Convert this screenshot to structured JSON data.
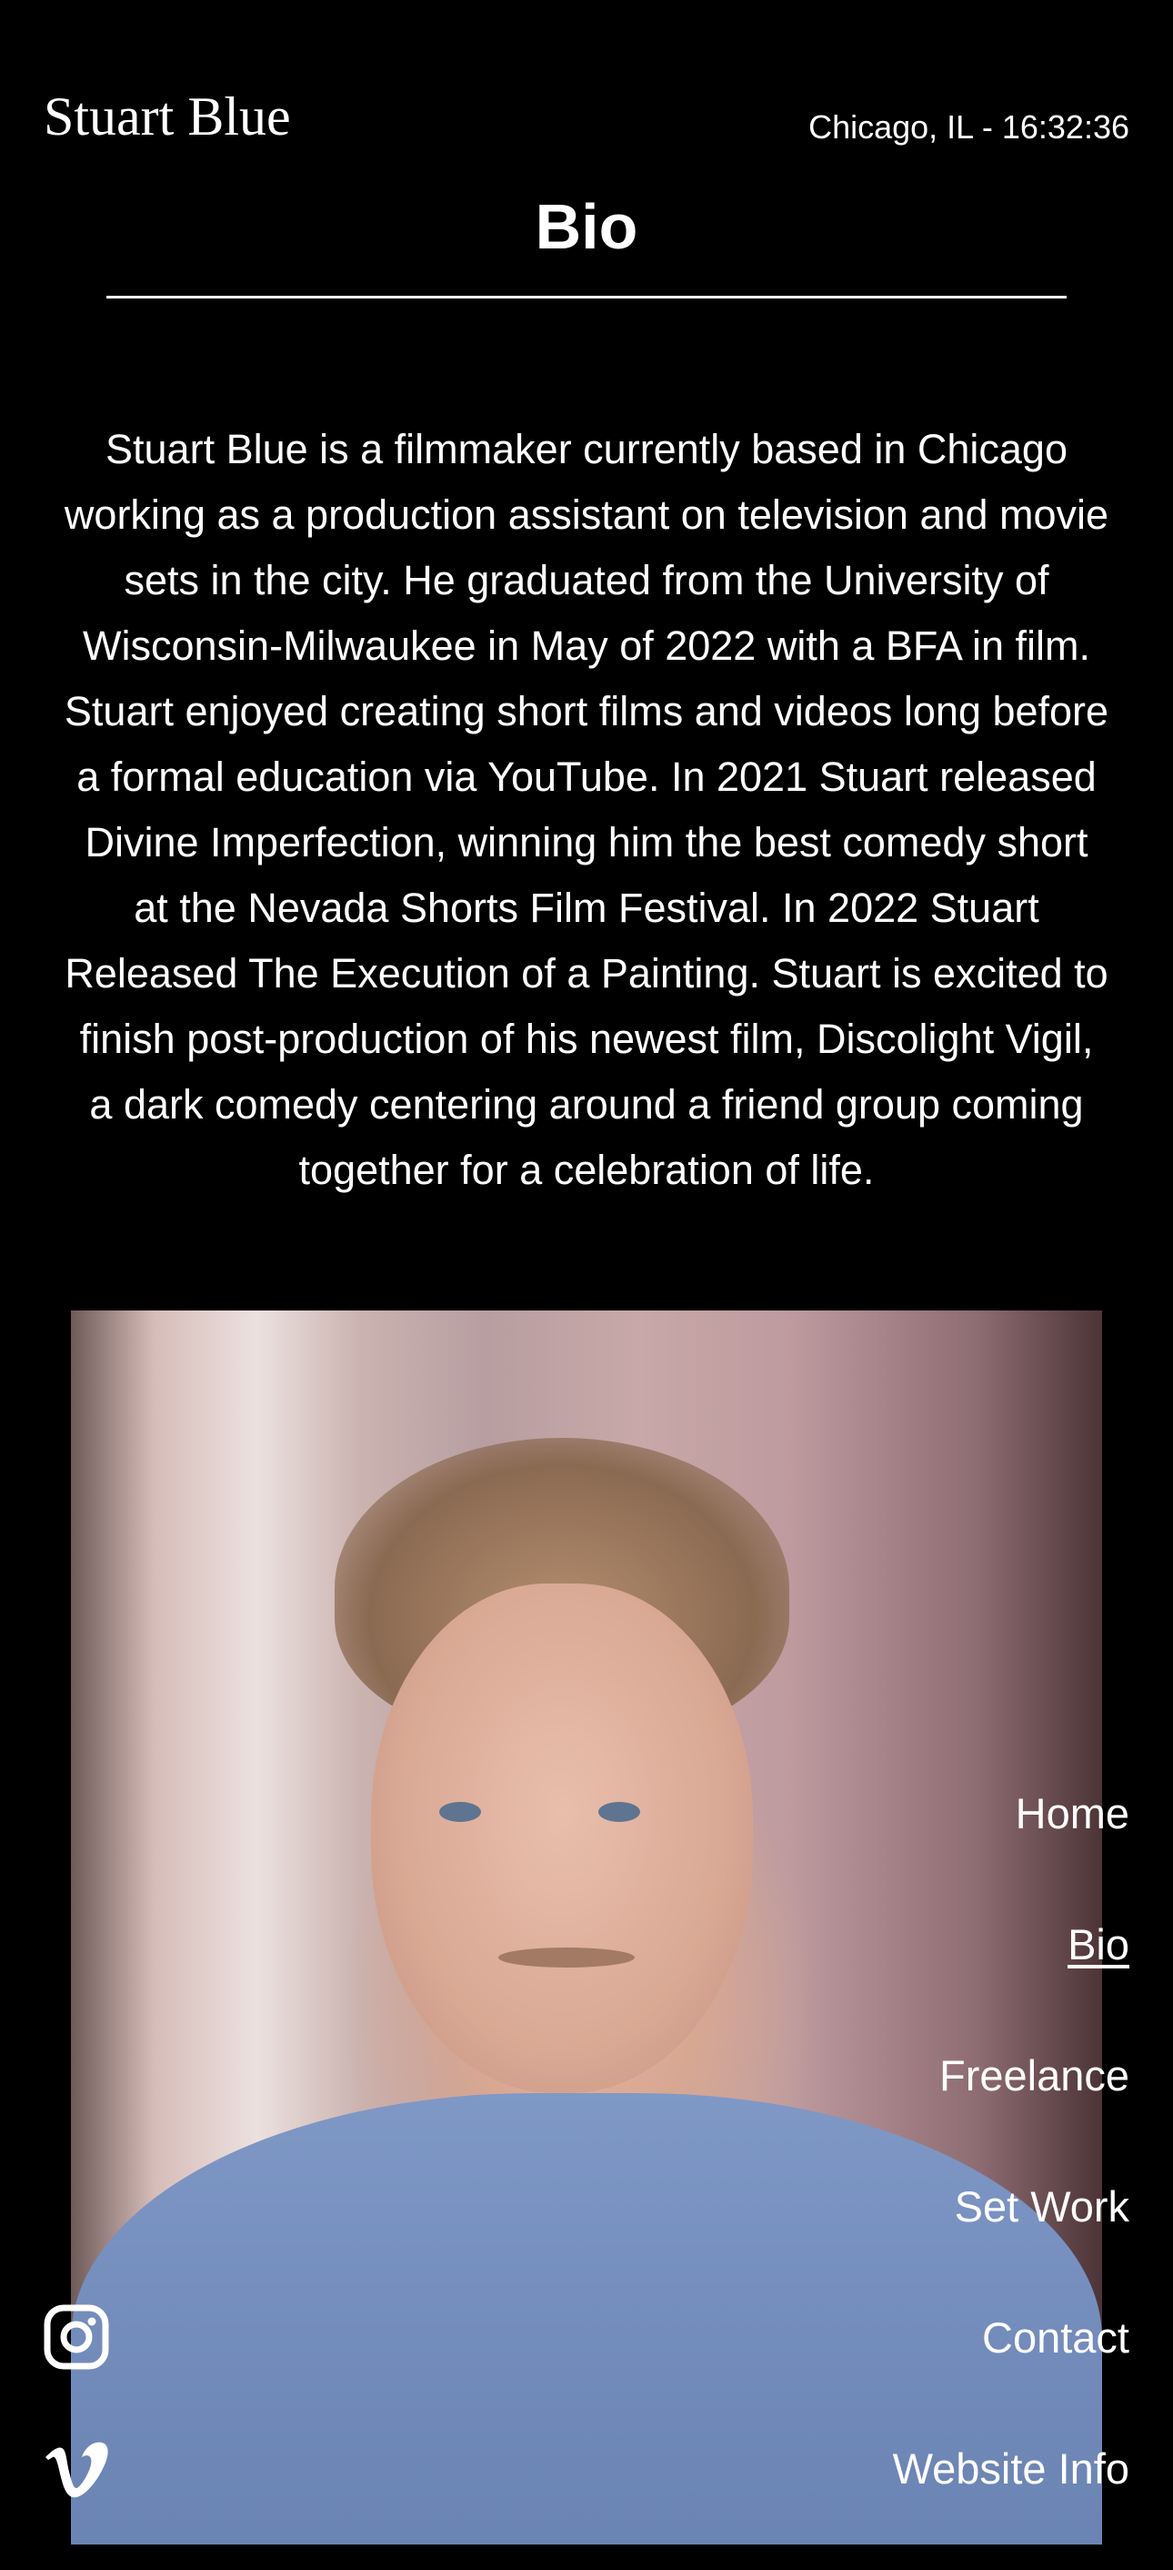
{
  "header": {
    "site_title": "Stuart Blue",
    "location_time": "Chicago, IL - 16:32:36"
  },
  "page": {
    "title": "Bio",
    "bio": "Stuart Blue is a filmmaker currently based in Chicago working as a production assistant on television and movie sets in the city. He graduated from the University of Wisconsin-Milwaukee in May of 2022 with a BFA in film. Stuart enjoyed creating short films and videos long before a formal education via YouTube. In 2021 Stuart released Divine Imperfection, winning him the best comedy short at the Nevada Shorts Film Festival. In 2022 Stuart Released The Execution of a Painting. Stuart is excited to finish post-production of his newest film, Discolight Vigil, a dark comedy centering around a friend group coming together for a celebration of life."
  },
  "nav": {
    "items": [
      {
        "label": "Home"
      },
      {
        "label": "Bio",
        "active": true
      },
      {
        "label": "Freelance"
      },
      {
        "label": "Set Work"
      },
      {
        "label": "Contact"
      },
      {
        "label": "Website Info"
      }
    ]
  },
  "social": {
    "icons": [
      "instagram-icon",
      "vimeo-icon"
    ]
  },
  "colors": {
    "background": "#000000",
    "text": "#ffffff"
  }
}
